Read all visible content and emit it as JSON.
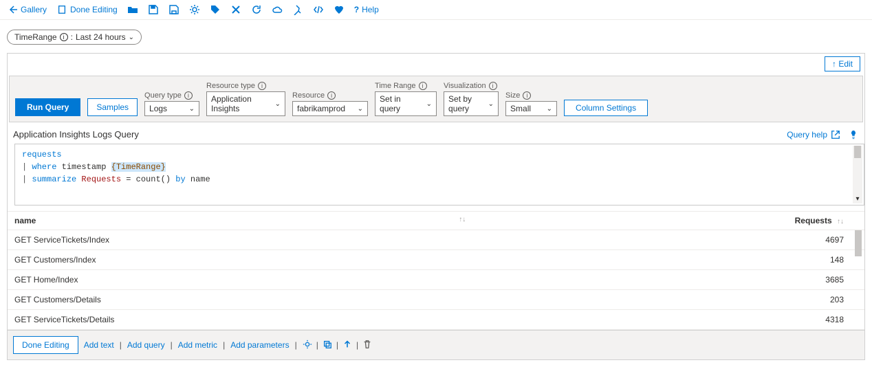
{
  "toolbar": {
    "gallery": "Gallery",
    "done_editing": "Done Editing",
    "help": "Help"
  },
  "param_pill": {
    "name": "TimeRange",
    "value": "Last 24 hours"
  },
  "edit_button": "↑ Edit",
  "query_bar": {
    "run": "Run Query",
    "samples": "Samples",
    "query_type": {
      "label": "Query type",
      "value": "Logs"
    },
    "resource_type": {
      "label": "Resource type",
      "value": "Application Insights"
    },
    "resource": {
      "label": "Resource",
      "value": "fabrikamprod"
    },
    "time_range": {
      "label": "Time Range",
      "value": "Set in query"
    },
    "visualization": {
      "label": "Visualization",
      "value": "Set by query"
    },
    "size": {
      "label": "Size",
      "value": "Small"
    },
    "column_settings": "Column Settings"
  },
  "section_title": "Application Insights Logs Query",
  "query_help": "Query help",
  "code": {
    "line1_table": "requests",
    "line2_pipe": "|",
    "line2_where": "where",
    "line2_field": "timestamp",
    "line2_token": "{TimeRange}",
    "line3_pipe": "|",
    "line3_summarize": "summarize",
    "line3_alias": "Requests",
    "line3_eq": "=",
    "line3_fn": "count()",
    "line3_by": "by",
    "line3_col": "name"
  },
  "table": {
    "columns": {
      "name": "name",
      "requests": "Requests"
    },
    "rows": [
      {
        "name": "GET ServiceTickets/Index",
        "requests": 4697
      },
      {
        "name": "GET Customers/Index",
        "requests": 148
      },
      {
        "name": "GET Home/Index",
        "requests": 3685
      },
      {
        "name": "GET Customers/Details",
        "requests": 203
      },
      {
        "name": "GET ServiceTickets/Details",
        "requests": 4318
      }
    ]
  },
  "footer": {
    "done_editing": "Done Editing",
    "add_text": "Add text",
    "add_query": "Add query",
    "add_metric": "Add metric",
    "add_parameters": "Add parameters"
  }
}
